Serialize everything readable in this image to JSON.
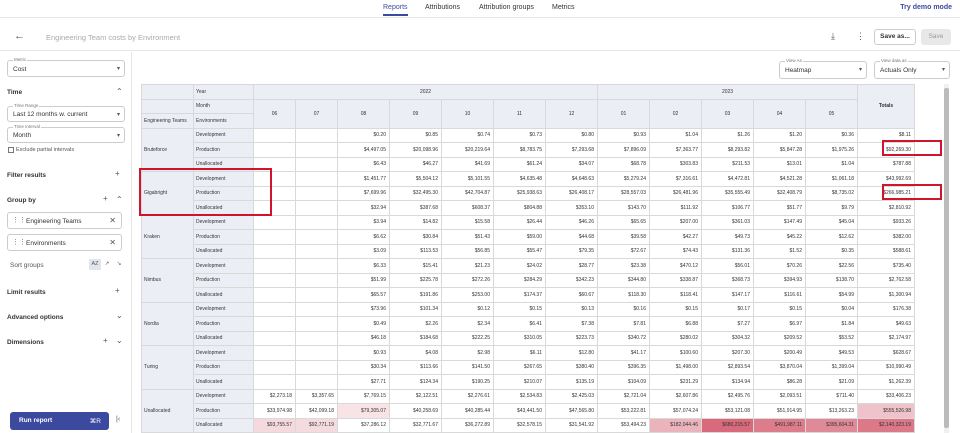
{
  "nav": {
    "tabs": [
      "Reports",
      "Attributions",
      "Attribution groups",
      "Metrics"
    ],
    "active": 0,
    "demo": "Try demo mode"
  },
  "header": {
    "title": "Engineering Team costs by Environment",
    "save_as": "Save as...",
    "save": "Save"
  },
  "sidebar": {
    "metric": {
      "label": "Metric",
      "value": "Cost"
    },
    "time_section": "Time",
    "time_range": {
      "label": "Time Range",
      "value": "Last 12 months w. current"
    },
    "time_interval": {
      "label": "Time Interval",
      "value": "Month"
    },
    "exclude_partial": "Exclude partial intervals",
    "filter_results": "Filter results",
    "group_by": "Group by",
    "group_items": [
      "Engineering Teams",
      "Environments"
    ],
    "sort_groups": "Sort groups",
    "sort_options": [
      "AZ",
      "↗",
      "↘"
    ],
    "limit_results": "Limit results",
    "advanced_options": "Advanced options",
    "dimensions": "Dimensions",
    "run_report": "Run report",
    "run_shortcut": "⌘R"
  },
  "view": {
    "view_as": {
      "label": "View As",
      "value": "Heatmap"
    },
    "view_data_as": {
      "label": "View data as",
      "value": "Actuals Only"
    }
  },
  "grid": {
    "year_label": "Year",
    "month_label": "Month",
    "teams_header": "Engineering Teams",
    "env_header": "Environments",
    "totals_header": "Totals",
    "years": [
      {
        "label": "2022",
        "span": 7
      },
      {
        "label": "2023",
        "span": 5
      }
    ],
    "months": [
      "06",
      "07",
      "08",
      "09",
      "10",
      "11",
      "12",
      "01",
      "02",
      "03",
      "04",
      "05"
    ],
    "teams": [
      {
        "name": "Bruteforce",
        "rows": [
          {
            "env": "Development",
            "values": [
              "",
              "",
              "$0.20",
              "$0.85",
              "$0.74",
              "$0.73",
              "$0.80",
              "$0.93",
              "$1.04",
              "$1.26",
              "$1.20",
              "$0.36"
            ],
            "total": "$8.11"
          },
          {
            "env": "Production",
            "values": [
              "",
              "",
              "$4,497.05",
              "$20,098.96",
              "$20,219.64",
              "$8,783.75",
              "$7,293.68",
              "$7,896.09",
              "$7,363.77",
              "$8,293.82",
              "$5,847.28",
              "$1,975.26"
            ],
            "total": "$92,269.30"
          },
          {
            "env": "Unallocated",
            "values": [
              "",
              "",
              "$6.43",
              "$46.27",
              "$41.69",
              "$61.24",
              "$34.07",
              "$68.78",
              "$303.83",
              "$211.53",
              "$13.01",
              "$1.04"
            ],
            "total": "$787.88"
          }
        ]
      },
      {
        "name": "Gigabright",
        "rows": [
          {
            "env": "Development",
            "values": [
              "",
              "",
              "$1,451.77",
              "$5,504.12",
              "$5,101.55",
              "$4,635.48",
              "$4,648.63",
              "$5,279.24",
              "$7,316.61",
              "$4,472.81",
              "$4,521.28",
              "$1,061.18"
            ],
            "total": "$43,992.69"
          },
          {
            "env": "Production",
            "values": [
              "",
              "",
              "$7,699.96",
              "$32,495.30",
              "$42,704.87",
              "$25,938.63",
              "$26,408.17",
              "$28,557.03",
              "$26,481.96",
              "$35,555.49",
              "$32,408.79",
              "$8,735.02"
            ],
            "total": "$266,985.21"
          },
          {
            "env": "Unallocated",
            "values": [
              "",
              "",
              "$32.94",
              "$387.68",
              "$608.37",
              "$804.88",
              "$353.10",
              "$143.70",
              "$111.92",
              "$106.77",
              "$51.77",
              "$9.79"
            ],
            "total": "$2,810.92"
          }
        ]
      },
      {
        "name": "Kraken",
        "rows": [
          {
            "env": "Development",
            "values": [
              "",
              "",
              "$3.94",
              "$14.82",
              "$15.58",
              "$26.44",
              "$46.26",
              "$65.65",
              "$207.00",
              "$361.03",
              "$147.49",
              "$45.04"
            ],
            "total": "$933.26"
          },
          {
            "env": "Production",
            "values": [
              "",
              "",
              "$6.62",
              "$30.84",
              "$51.43",
              "$59.00",
              "$44.68",
              "$39.58",
              "$42.27",
              "$49.73",
              "$45.22",
              "$12.62"
            ],
            "total": "$382.00"
          },
          {
            "env": "Unallocated",
            "values": [
              "",
              "",
              "$3.09",
              "$113.53",
              "$56.85",
              "$55.47",
              "$79.35",
              "$72.67",
              "$74.43",
              "$131.36",
              "$1.52",
              "$0.35"
            ],
            "total": "$588.61"
          }
        ]
      },
      {
        "name": "Nimbus",
        "rows": [
          {
            "env": "Development",
            "values": [
              "",
              "",
              "$6.33",
              "$15.41",
              "$21.23",
              "$24.02",
              "$28.77",
              "$23.38",
              "$470.12",
              "$56.01",
              "$70.26",
              "$22.56"
            ],
            "total": "$735.40"
          },
          {
            "env": "Production",
            "values": [
              "",
              "",
              "$51.99",
              "$225.78",
              "$272.26",
              "$284.29",
              "$342.23",
              "$344.80",
              "$338.87",
              "$368.73",
              "$394.93",
              "$138.70"
            ],
            "total": "$2,762.58"
          },
          {
            "env": "Unallocated",
            "values": [
              "",
              "",
              "$65.57",
              "$191.86",
              "$253.00",
              "$174.37",
              "$60.67",
              "$118.30",
              "$118.41",
              "$147.17",
              "$116.61",
              "$54.99"
            ],
            "total": "$1,300.94"
          }
        ]
      },
      {
        "name": "Nordia",
        "rows": [
          {
            "env": "Development",
            "values": [
              "",
              "",
              "$73.96",
              "$101.34",
              "$0.12",
              "$0.15",
              "$0.13",
              "$0.16",
              "$0.15",
              "$0.17",
              "$0.15",
              "$0.04"
            ],
            "total": "$176.38"
          },
          {
            "env": "Production",
            "values": [
              "",
              "",
              "$0.49",
              "$2.26",
              "$2.34",
              "$6.41",
              "$7.38",
              "$7.81",
              "$6.88",
              "$7.27",
              "$6.97",
              "$1.84"
            ],
            "total": "$49.63"
          },
          {
            "env": "Unallocated",
            "values": [
              "",
              "",
              "$46.18",
              "$184.68",
              "$222.25",
              "$310.05",
              "$223.73",
              "$340.72",
              "$280.02",
              "$304.32",
              "$209.52",
              "$53.52"
            ],
            "total": "$2,174.97"
          }
        ]
      },
      {
        "name": "Turing",
        "rows": [
          {
            "env": "Development",
            "values": [
              "",
              "",
              "$0.93",
              "$4.08",
              "$2.98",
              "$6.11",
              "$12.80",
              "$41.17",
              "$100.60",
              "$207.30",
              "$200.49",
              "$49.53"
            ],
            "total": "$628.67"
          },
          {
            "env": "Production",
            "values": [
              "",
              "",
              "$30.34",
              "$113.66",
              "$141.50",
              "$267.65",
              "$380.40",
              "$396.35",
              "$1,498.00",
              "$2,893.54",
              "$3,870.04",
              "$1,399.04"
            ],
            "total": "$10,990.49"
          },
          {
            "env": "Unallocated",
            "values": [
              "",
              "",
              "$27.71",
              "$124.34",
              "$190.25",
              "$210.07",
              "$135.19",
              "$104.09",
              "$231.29",
              "$134.94",
              "$86.28",
              "$21.09"
            ],
            "total": "$1,262.39"
          }
        ]
      },
      {
        "name": "Unallocated",
        "rows": [
          {
            "env": "Development",
            "values": [
              "$2,273.18",
              "$3,357.65",
              "$7,769.15",
              "$2,122.51",
              "$2,276.61",
              "$2,534.83",
              "$2,425.03",
              "$2,721.04",
              "$2,607.86",
              "$2,495.76",
              "$2,093.51",
              "$711.40"
            ],
            "total": "$33,406.23"
          },
          {
            "env": "Production",
            "values": [
              "$33,974.98",
              "$42,099.18",
              "$79,305.07",
              "$40,258.69",
              "$40,285.44",
              "$43,441.50",
              "$47,565.80",
              "$53,222.81",
              "$57,074.24",
              "$53,121.08",
              "$51,914.95",
              "$13,263.23"
            ],
            "total": "$555,526.98"
          },
          {
            "env": "Unallocated",
            "values": [
              "$93,755.57",
              "$92,771.19",
              "$37,286.12",
              "$32,771.67",
              "$36,272.89",
              "$32,578.15",
              "$31,541.92",
              "$53,494.23",
              "$182,044.46",
              "$680,215.57",
              "$491,987.11",
              "$395,604.31"
            ],
            "total": "$2,140,323.19"
          }
        ]
      }
    ]
  },
  "colors": {
    "accent": "#3b4a9f",
    "highlight": "#d0142c",
    "heat_max": "#d25468"
  }
}
